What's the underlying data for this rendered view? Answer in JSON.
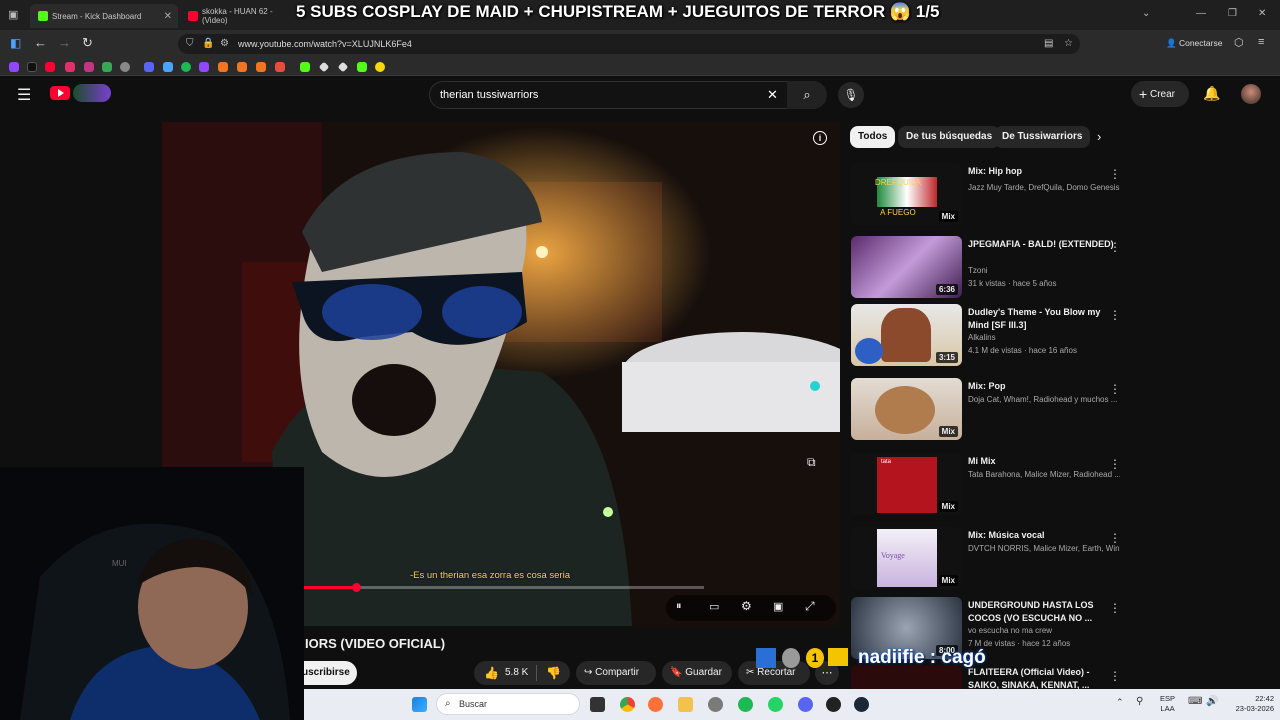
{
  "browser": {
    "tabs": [
      {
        "title": "Stream - Kick Dashboard"
      },
      {
        "title": "skokka - HUAN 62 - (Video)"
      }
    ],
    "url": "www.youtube.com/watch?v=XLUJNLK6Fe4",
    "connect_label": "Conectarse"
  },
  "stream_overlay": {
    "title": "5 SUBS COSPLAY DE MAID + CHUPISTREAM + JUEGUITOS DE TERROR",
    "counter": "1/5",
    "alert_text": "nadiifie : cagó"
  },
  "youtube": {
    "search_query": "therian tussiwarriors",
    "create_label": "Crear",
    "video": {
      "subtitle": "-Es un therian esa zorra es cosa seria",
      "title": "IORS (VIDEO OFICIAL)",
      "progress": 0.13,
      "subscribe_label": "uscribirse",
      "likes": "5.8 K",
      "share_label": "Compartir",
      "save_label": "Guardar",
      "clip_label": "Recortar"
    },
    "chips": [
      "Todos",
      "De tus búsquedas",
      "De Tussiwarriors"
    ],
    "recommendations": [
      {
        "title": "Mix: Hip hop",
        "channel": "Jazz Muy Tarde, DrefQuila, Domo Genesis y ...",
        "meta": "",
        "badge": "Mix",
        "thumb_text": "DREFQUILA\nA FUEGO"
      },
      {
        "title": "JPEGMAFIA - BALD! (EXTENDED)",
        "channel": "Tzoni",
        "meta": "31 k vistas · hace 5 años",
        "badge": "6:36",
        "thumb_text": ""
      },
      {
        "title": "Dudley's Theme - You Blow my Mind [SF III.3]",
        "channel": "Alkalins",
        "meta": "4.1 M de vistas · hace 16 años",
        "badge": "3:15",
        "thumb_text": ""
      },
      {
        "title": "Mix: Pop",
        "channel": "Doja Cat, Wham!, Radiohead y muchos ...",
        "meta": "",
        "badge": "Mix",
        "thumb_text": ""
      },
      {
        "title": "Mi Mix",
        "channel": "Tata Barahona, Malice Mizer, Radiohead ...",
        "meta": "",
        "badge": "Mix",
        "thumb_text": "tata"
      },
      {
        "title": "Mix: Música vocal",
        "channel": "DVTCH NORRIS, Malice Mizer, Earth, Win...",
        "meta": "",
        "badge": "Mix",
        "thumb_text": "Voyage"
      },
      {
        "title": "UNDERGROUND HASTA LOS COCOS (VO ESCUCHA NO ...",
        "channel": "vo escucha no ma crew",
        "meta": "7 M de vistas · hace 12 años",
        "badge": "8:00",
        "thumb_text": ""
      },
      {
        "title": "FLAITEERA (Official Video) - SAIKO, SINAKA, KENNAT, ...",
        "channel": "",
        "meta": "",
        "badge": "",
        "thumb_text": ""
      }
    ]
  },
  "taskbar": {
    "search_placeholder": "Buscar",
    "lang": "ESP",
    "lang2": "LAA",
    "time": "22:42",
    "date": "23-03-2026"
  },
  "colors": {
    "yt_red": "#ff0033",
    "kick_green": "#53fc18",
    "accent_blue": "#3ea6ff"
  }
}
